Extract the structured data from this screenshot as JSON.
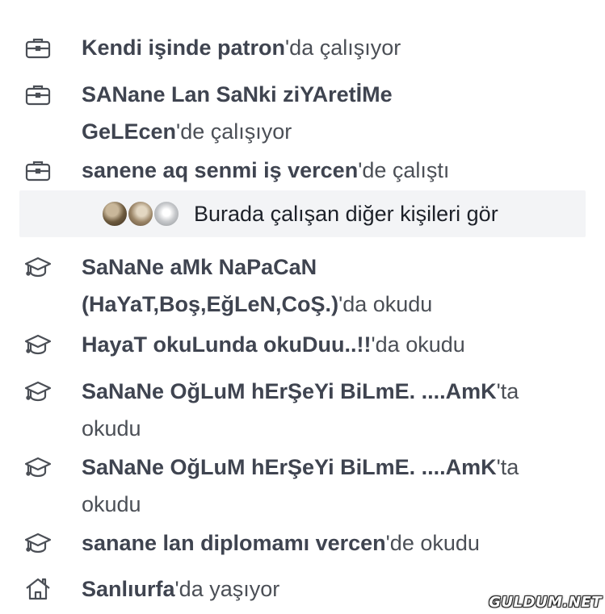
{
  "work": [
    {
      "name": "Kendi işinde patron",
      "suffix": "'da çalışıyor",
      "icon": "briefcase-icon"
    },
    {
      "name": "SANane Lan SaNki ziYAretİMe GeLEcen",
      "suffix": "'de çalışıyor",
      "icon": "briefcase-icon"
    },
    {
      "name": "sanene aq senmi iş vercen",
      "suffix": "'de çalıştı",
      "icon": "briefcase-icon"
    }
  ],
  "see_others": {
    "label": "Burada çalışan diğer kişileri gör"
  },
  "education": [
    {
      "name": "SaNaNe aMk NaPaCaN (HaYaT,Boş,EğLeN,CoŞ.)",
      "suffix": "'da okudu",
      "icon": "graduation-cap-icon"
    },
    {
      "name": "HayaT okuLunda okuDuu..!!",
      "suffix": "'da okudu",
      "icon": "graduation-cap-icon"
    },
    {
      "name": "SaNaNe OğLuM hErŞeYi BiLmE. ....AmK",
      "suffix": "'ta okudu",
      "icon": "graduation-cap-icon"
    },
    {
      "name": "SaNaNe OğLuM hErŞeYi BiLmE. ....AmK",
      "suffix": "'ta okudu",
      "icon": "graduation-cap-icon"
    },
    {
      "name": "sanane lan diplomamı vercen",
      "suffix": "'de okudu",
      "icon": "graduation-cap-icon"
    }
  ],
  "lives": {
    "name": "Sanlıurfa",
    "suffix": "'da yaşıyor",
    "icon": "house-icon"
  },
  "watermark": "GULDUM.NET"
}
